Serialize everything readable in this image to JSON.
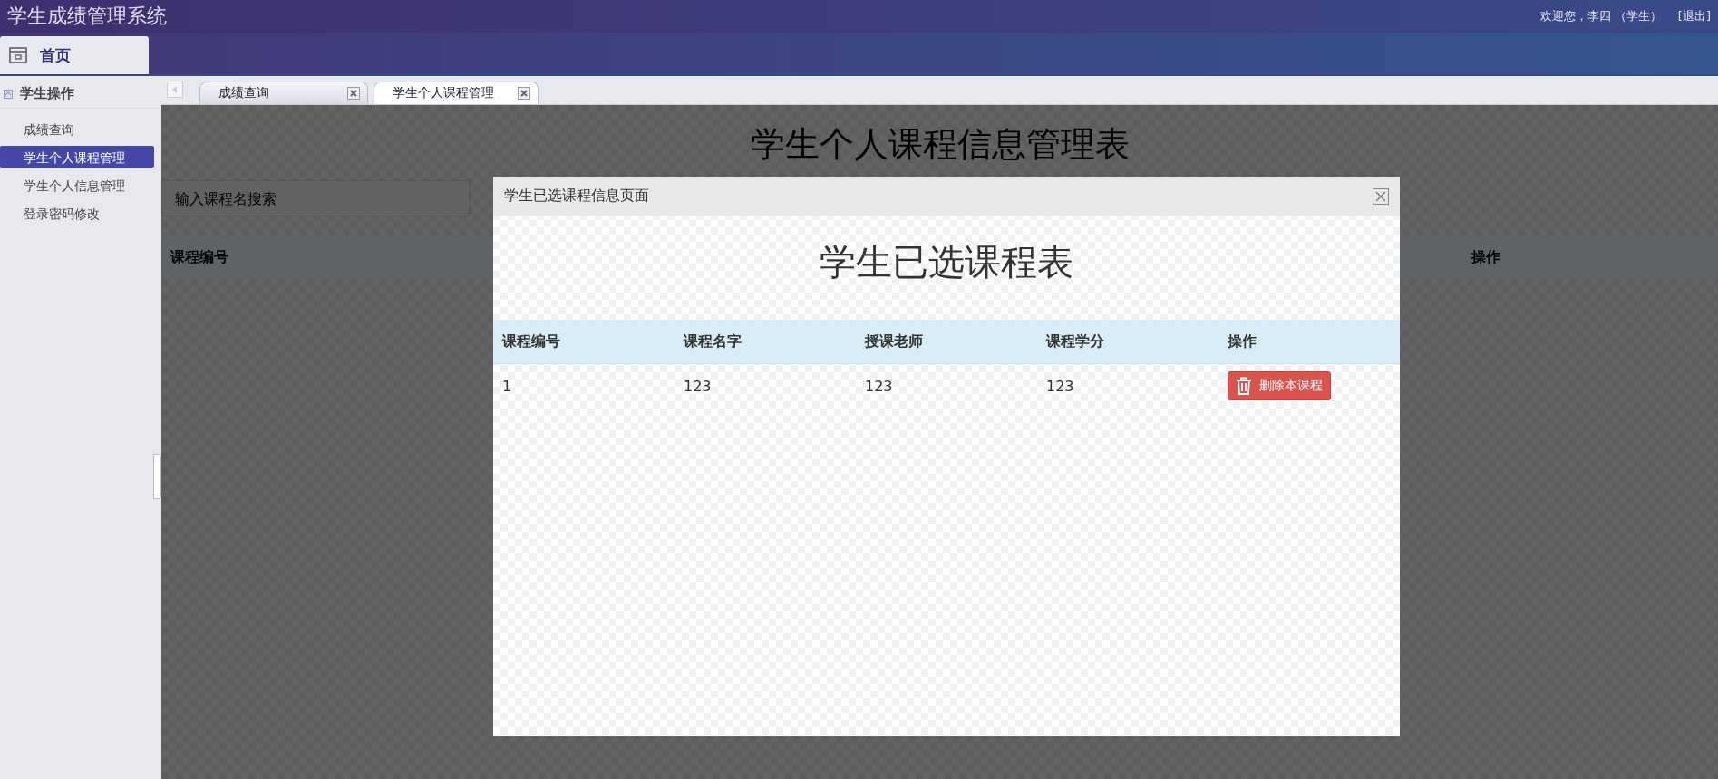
{
  "app_title": "学生成绩管理系统",
  "user_info": "欢迎您，李四 （学生）",
  "logout": "[退出]",
  "home_tab": {
    "label": "首页",
    "selected": true
  },
  "sidebar": {
    "group": "学生操作",
    "expanded": true,
    "items": [
      {
        "label": "成绩查询",
        "selected": false
      },
      {
        "label": "学生个人课程管理",
        "selected": true
      },
      {
        "label": "学生个人信息管理",
        "selected": false
      },
      {
        "label": "登录密码修改",
        "selected": false
      }
    ]
  },
  "tabs": [
    {
      "label": "成绩查询",
      "selected": false
    },
    {
      "label": "学生个人课程管理",
      "selected": true
    }
  ],
  "page": {
    "title": "学生个人课程信息管理表",
    "search": {
      "placeholder": "输入课程名搜索"
    },
    "columns": [
      {
        "label": "课程编号"
      },
      {
        "label": "操作"
      }
    ]
  },
  "dialog": {
    "title": "学生已选课程信息页面",
    "heading": "学生已选课程表",
    "columns": [
      "课程编号",
      "课程名字",
      "授课老师",
      "课程学分",
      "操作"
    ],
    "rows": [
      {
        "cells": [
          "1",
          "123",
          "123",
          "123"
        ],
        "action": "删除本课程"
      }
    ]
  }
}
